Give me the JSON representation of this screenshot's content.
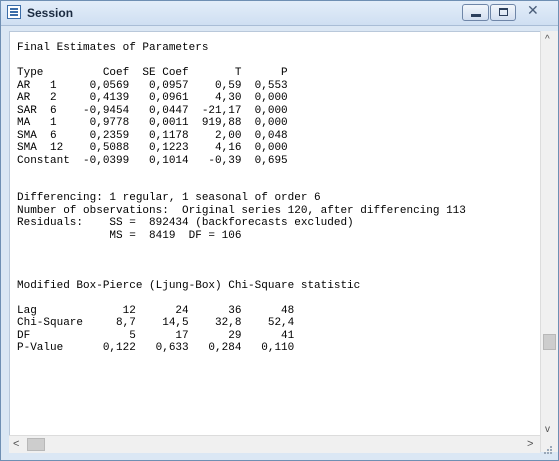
{
  "window": {
    "title": "Session",
    "icon": "session-icon",
    "controls": [
      "minimize-icon",
      "maximize-icon",
      "close-icon"
    ]
  },
  "session_output": "Final Estimates of Parameters\n\nType         Coef  SE Coef       T      P\nAR   1     0,0569   0,0957    0,59  0,553\nAR   2     0,4139   0,0961    4,30  0,000\nSAR  6    -0,9454   0,0447  -21,17  0,000\nMA   1     0,9778   0,0011  919,88  0,000\nSMA  6     0,2359   0,1178    2,00  0,048\nSMA  12    0,5088   0,1223    4,16  0,000\nConstant  -0,0399   0,1014   -0,39  0,695\n\n\nDifferencing: 1 regular, 1 seasonal of order 6\nNumber of observations:  Original series 120, after differencing 113\nResiduals:    SS =  892434 (backforecasts excluded)\n              MS =  8419  DF = 106\n\n\n\nModified Box-Pierce (Ljung-Box) Chi-Square statistic\n\nLag             12      24      36      48\nChi-Square     8,7    14,5    32,8    52,4\nDF               5      17      29      41\nP-Value      0,122   0,633   0,284   0,110",
  "scrollbars": {
    "up_arrow": "^",
    "down_arrow": "v",
    "left_arrow": "<",
    "right_arrow": ">"
  }
}
